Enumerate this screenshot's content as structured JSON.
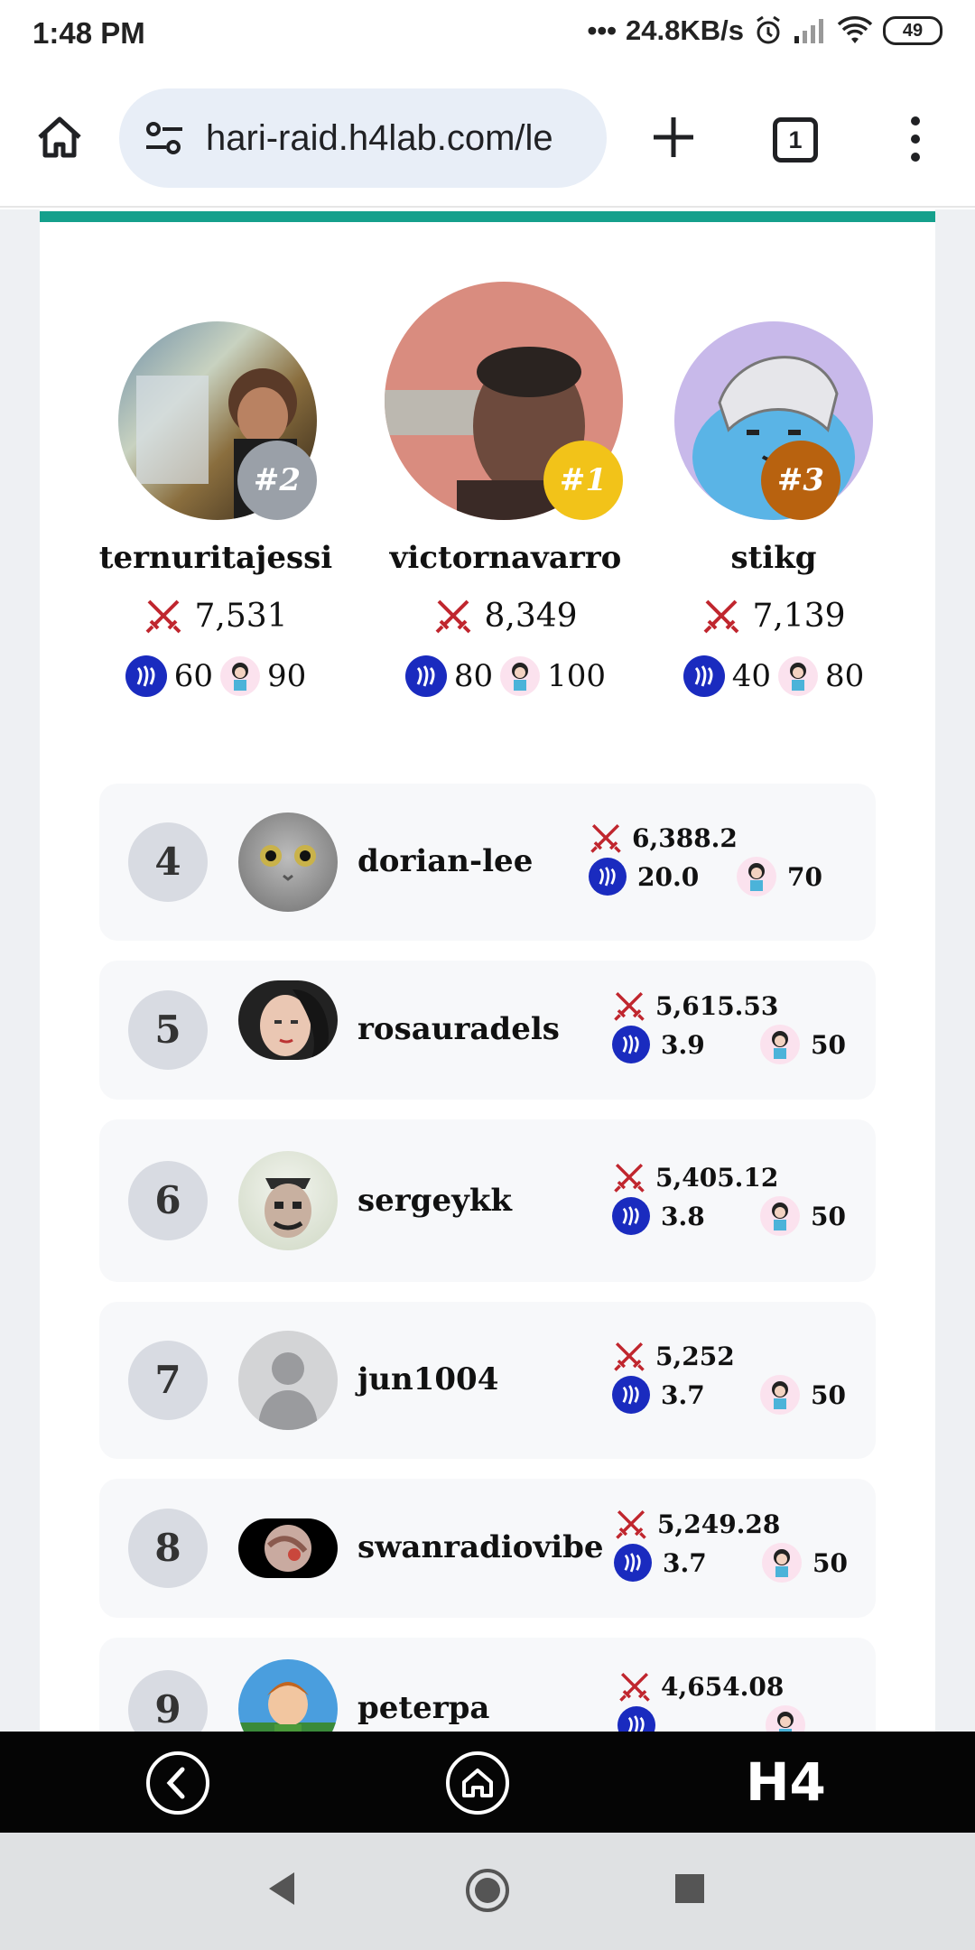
{
  "status_bar": {
    "time": "1:48 PM",
    "network_speed": "24.8KB/s",
    "battery": "49"
  },
  "browser": {
    "url": "hari-raid.h4lab.com/le",
    "tab_count": "1"
  },
  "colors": {
    "accent": "#15a08c",
    "rank_gold": "#f2c319",
    "rank_silver": "#9aa0a8",
    "rank_bronze": "#b8620f",
    "coin_blue": "#1a2bbf",
    "sword_red": "#c0262e"
  },
  "podium": [
    {
      "rank": "#2",
      "name": "ternuritajessi",
      "points": "7,531",
      "coin": "60",
      "chibi": "90"
    },
    {
      "rank": "#1",
      "name": "victornavarro",
      "points": "8,349",
      "coin": "80",
      "chibi": "100"
    },
    {
      "rank": "#3",
      "name": "stikg",
      "points": "7,139",
      "coin": "40",
      "chibi": "80"
    }
  ],
  "leaderboard": [
    {
      "rank": "4",
      "name": "dorian-lee",
      "points": "6,388.2",
      "coin": "20.0",
      "chibi": "70"
    },
    {
      "rank": "5",
      "name": "rosauradels",
      "points": "5,615.53",
      "coin": "3.9",
      "chibi": "50"
    },
    {
      "rank": "6",
      "name": "sergeykk",
      "points": "5,405.12",
      "coin": "3.8",
      "chibi": "50"
    },
    {
      "rank": "7",
      "name": "jun1004",
      "points": "5,252",
      "coin": "3.7",
      "chibi": "50"
    },
    {
      "rank": "8",
      "name": "swanradiovibe",
      "points": "5,249.28",
      "coin": "3.7",
      "chibi": "50"
    },
    {
      "rank": "9",
      "name": "peterpa",
      "points": "4,654.08",
      "coin": "",
      "chibi": ""
    }
  ],
  "app_nav": {
    "logo": "H4"
  }
}
